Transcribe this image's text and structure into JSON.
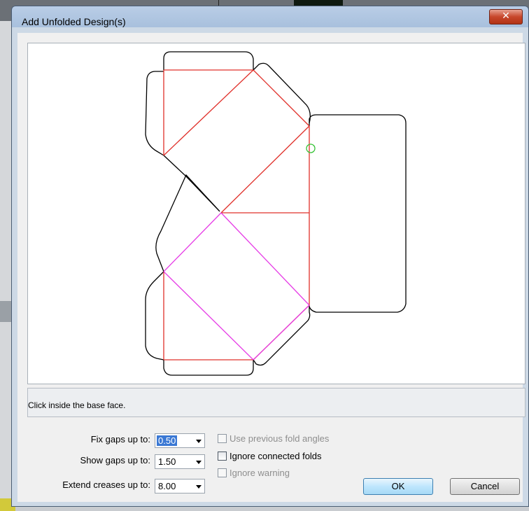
{
  "window": {
    "title": "Add Unfolded Design(s)",
    "close_glyph": "✕"
  },
  "status": {
    "message": "Click inside the base face."
  },
  "fields": [
    {
      "label": "Fix gaps up to:",
      "value": "0.50",
      "selected": true
    },
    {
      "label": "Show gaps up to:",
      "value": "1.50",
      "selected": false
    },
    {
      "label": "Extend creases up to:",
      "value": "8.00",
      "selected": false
    }
  ],
  "checkboxes": [
    {
      "label": "Use previous fold angles",
      "checked": false,
      "enabled": false
    },
    {
      "label": "Ignore connected folds",
      "checked": false,
      "enabled": true
    },
    {
      "label": "Ignore warning",
      "checked": false,
      "enabled": false
    }
  ],
  "buttons": {
    "ok": "OK",
    "cancel": "Cancel"
  },
  "colors": {
    "cut_line": "#000000",
    "fold_line_red": "#e0302a",
    "fold_line_magenta": "#e63ce6",
    "marker_green": "#35c235"
  }
}
